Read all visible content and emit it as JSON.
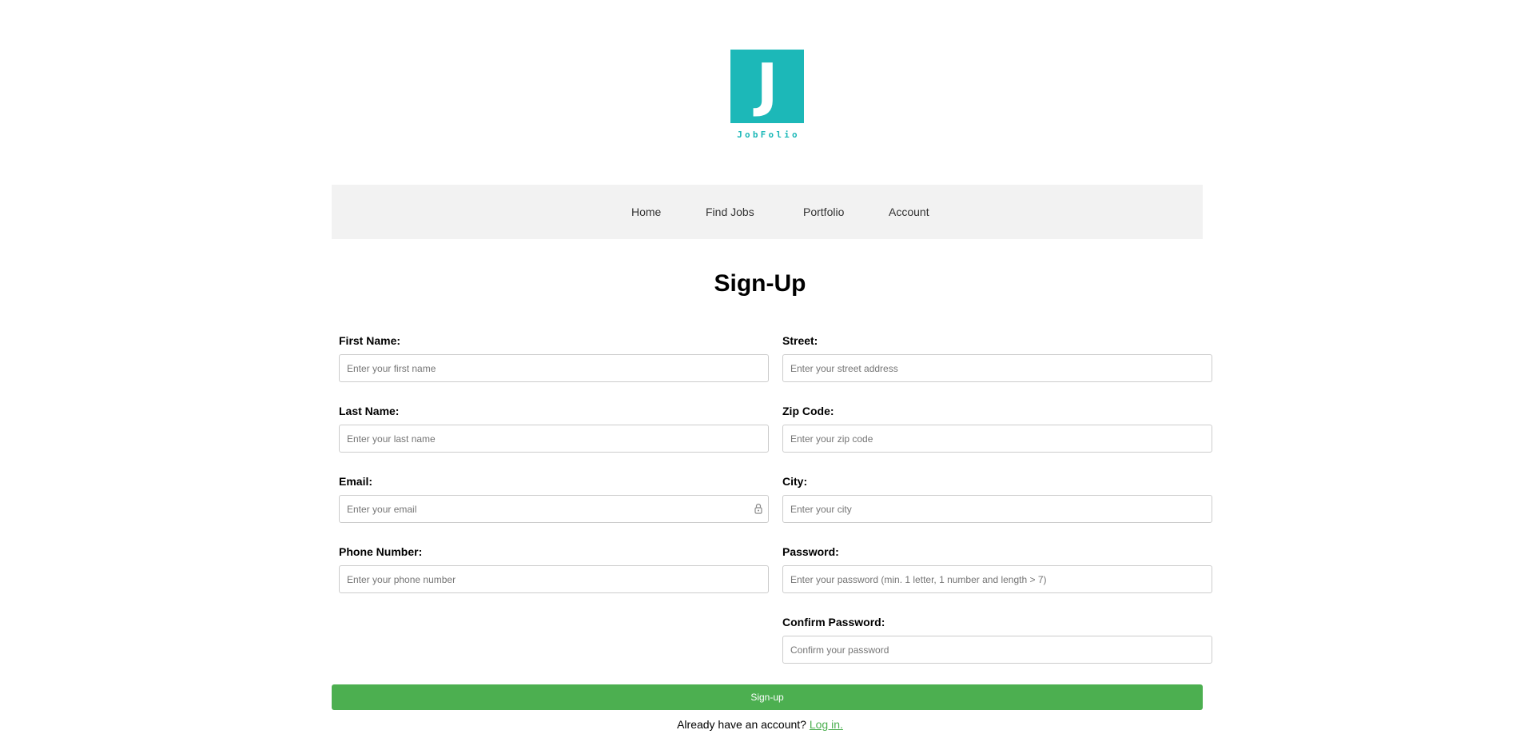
{
  "logo": {
    "letter": "J",
    "name": "JobFolio",
    "color": "#1cb8b8"
  },
  "nav": {
    "items": [
      {
        "label": "Home"
      },
      {
        "label": "Find Jobs"
      },
      {
        "label": "Portfolio"
      },
      {
        "label": "Account"
      }
    ]
  },
  "page_title": "Sign-Up",
  "form": {
    "left": [
      {
        "label": "First Name:",
        "placeholder": "Enter your first name",
        "value": ""
      },
      {
        "label": "Last Name:",
        "placeholder": "Enter your last name",
        "value": ""
      },
      {
        "label": "Email:",
        "placeholder": "Enter your email",
        "value": "",
        "icon": "password-manager-key-icon"
      },
      {
        "label": "Phone Number:",
        "placeholder": "Enter your phone number",
        "value": ""
      }
    ],
    "right": [
      {
        "label": "Street:",
        "placeholder": "Enter your street address",
        "value": ""
      },
      {
        "label": "Zip Code:",
        "placeholder": "Enter your zip code",
        "value": ""
      },
      {
        "label": "City:",
        "placeholder": "Enter your city",
        "value": ""
      },
      {
        "label": "Password:",
        "placeholder": "Enter your password (min. 1 letter, 1 number and length > 7)",
        "value": ""
      },
      {
        "label": "Confirm Password:",
        "placeholder": "Confirm your password",
        "value": ""
      }
    ],
    "submit_label": "Sign-up"
  },
  "login_prompt": {
    "text": "Already have an account?",
    "link_label": "Log in."
  },
  "colors": {
    "accent": "#4caf50",
    "nav_background": "#f2f2f2"
  }
}
